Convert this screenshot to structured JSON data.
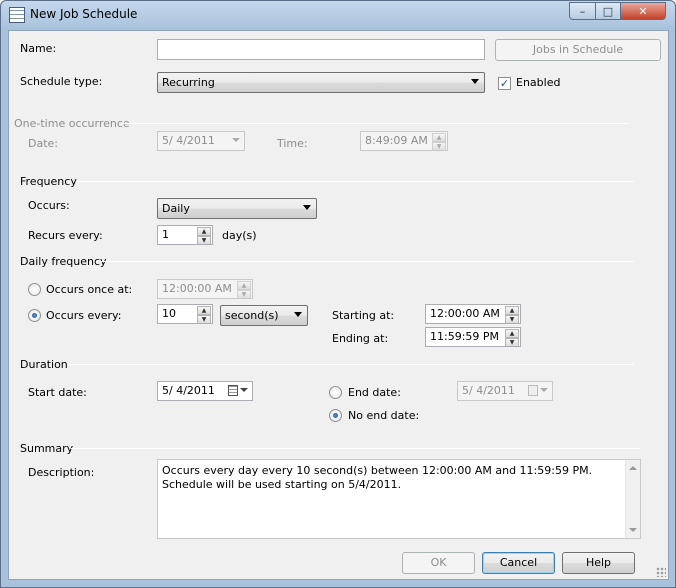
{
  "window": {
    "title": "New Job Schedule",
    "minimize": "–",
    "maximize": "□",
    "close": "✕"
  },
  "general": {
    "name_label": "Name:",
    "name_value": "",
    "jobs_button": "Jobs in Schedule",
    "schedule_type_label": "Schedule type:",
    "schedule_type_value": "Recurring",
    "enabled_label": "Enabled",
    "enabled_checked": true
  },
  "one_time": {
    "section_label": "One-time occurrence",
    "date_label": "Date:",
    "date_value": "5/  4/2011",
    "time_label": "Time:",
    "time_value": "8:49:09 AM"
  },
  "frequency": {
    "section_label": "Frequency",
    "occurs_label": "Occurs:",
    "occurs_value": "Daily",
    "recurs_label": "Recurs every:",
    "recurs_value": "1",
    "recurs_unit": "day(s)"
  },
  "daily_frequency": {
    "section_label": "Daily frequency",
    "once_label": "Occurs once at:",
    "once_value": "12:00:00 AM",
    "every_label": "Occurs every:",
    "every_value": "10",
    "every_unit": "second(s)",
    "starting_label": "Starting at:",
    "starting_value": "12:00:00 AM",
    "ending_label": "Ending at:",
    "ending_value": "11:59:59 PM",
    "selected": "every"
  },
  "duration": {
    "section_label": "Duration",
    "start_label": "Start date:",
    "start_value": "5/  4/2011",
    "end_label": "End date:",
    "end_value": "5/  4/2011",
    "no_end_label": "No end date:",
    "selected": "no_end"
  },
  "summary": {
    "section_label": "Summary",
    "description_label": "Description:",
    "description_value": "Occurs every day every 10 second(s) between 12:00:00 AM and 11:59:59 PM. Schedule will be used starting on 5/4/2011."
  },
  "buttons": {
    "ok": "OK",
    "cancel": "Cancel",
    "help": "Help"
  },
  "colors": {
    "accent": "#3c7fb1",
    "disabled_text": "#8d8d8d",
    "title_bar": "#a9c2dc"
  }
}
